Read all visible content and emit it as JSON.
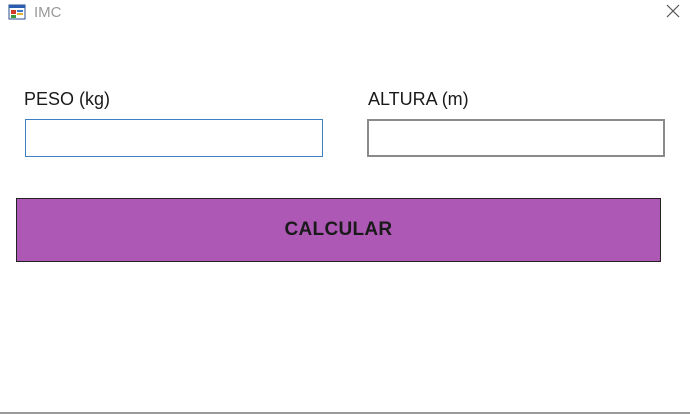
{
  "window": {
    "title": "IMC",
    "icon": "winforms-app-icon",
    "close_icon": "close-icon"
  },
  "form": {
    "peso": {
      "label": "PESO (kg)",
      "value": ""
    },
    "altura": {
      "label": "ALTURA (m)",
      "value": ""
    },
    "calculate_button": {
      "label": "CALCULAR"
    }
  },
  "colors": {
    "button_background": "#ad58b5",
    "focused_input_border": "#3d7fc1",
    "input_border": "#8a8a8a",
    "title_text": "#9a9a9a"
  }
}
